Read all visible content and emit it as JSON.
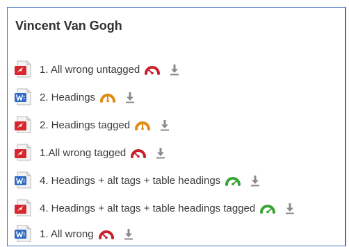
{
  "section": {
    "title": "Vincent Van Gogh"
  },
  "files": [
    {
      "label": "1. All wrong untagged",
      "file_icon": "pdf-icon",
      "status": "red",
      "status_icon": "gauge-low-icon"
    },
    {
      "label": "2. Headings",
      "file_icon": "word-doc-icon",
      "status": "orange",
      "status_icon": "gauge-mid-icon"
    },
    {
      "label": "2. Headings tagged",
      "file_icon": "pdf-icon",
      "status": "orange",
      "status_icon": "gauge-mid-icon"
    },
    {
      "label": "1.All wrong tagged",
      "file_icon": "pdf-icon",
      "status": "red",
      "status_icon": "gauge-low-icon"
    },
    {
      "label": "4. Headings + alt tags + table headings",
      "file_icon": "word-doc-icon",
      "status": "green",
      "status_icon": "gauge-high-icon"
    },
    {
      "label": "4. Headings + alt tags + table headings tagged",
      "file_icon": "pdf-icon",
      "status": "green",
      "status_icon": "gauge-high-icon"
    },
    {
      "label": "1. All wrong",
      "file_icon": "word-doc-icon",
      "status": "red",
      "status_icon": "gauge-low-icon"
    }
  ],
  "colors": {
    "red": "#c8202a",
    "orange": "#e08a12",
    "green": "#3aa335",
    "border": "#4a73c4",
    "download": "#8a8a8a"
  }
}
